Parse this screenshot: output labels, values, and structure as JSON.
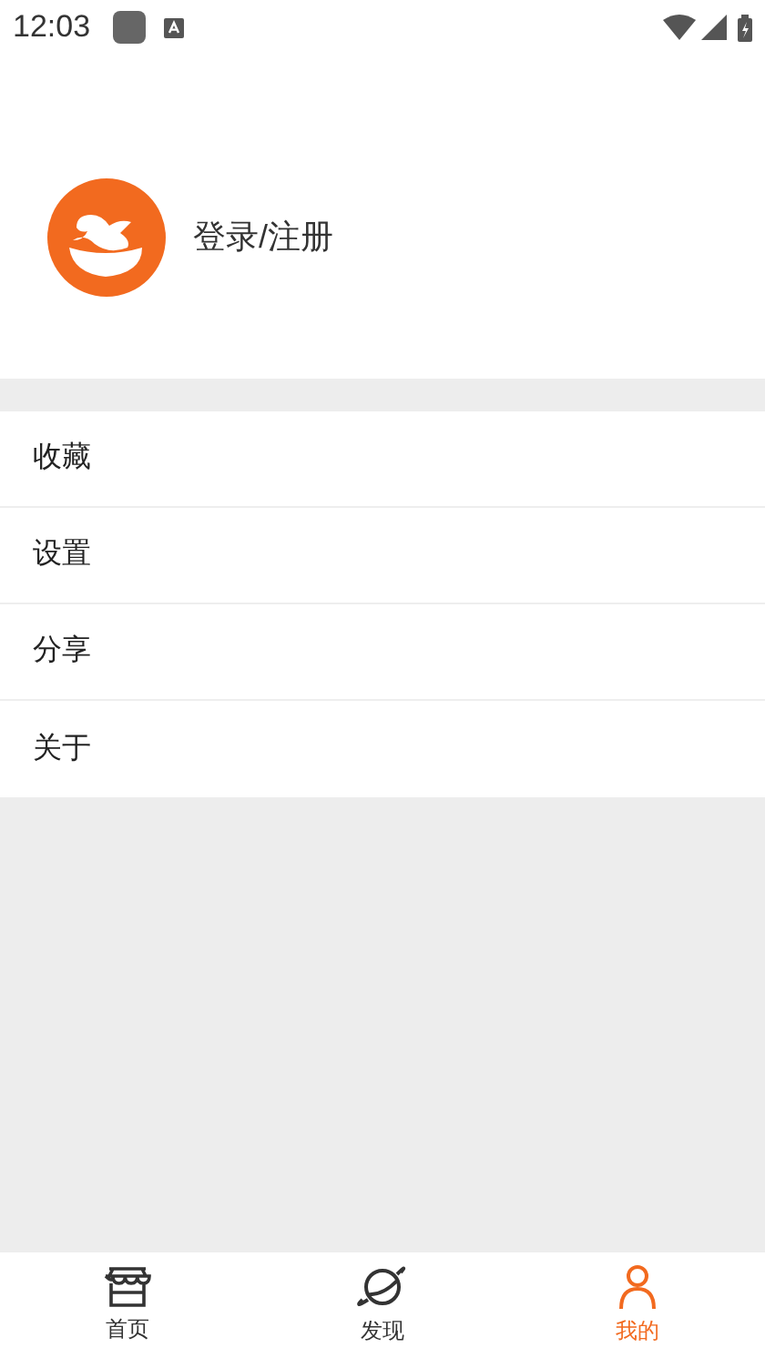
{
  "status_bar": {
    "time": "12:03"
  },
  "profile": {
    "label": "登录/注册"
  },
  "menu": [
    {
      "label": "收藏"
    },
    {
      "label": "设置"
    },
    {
      "label": "分享"
    },
    {
      "label": "关于"
    }
  ],
  "tabs": [
    {
      "kind": "home",
      "label": "首页",
      "selected": false
    },
    {
      "kind": "discover",
      "label": "发现",
      "selected": false
    },
    {
      "kind": "me",
      "label": "我的",
      "selected": true
    }
  ]
}
